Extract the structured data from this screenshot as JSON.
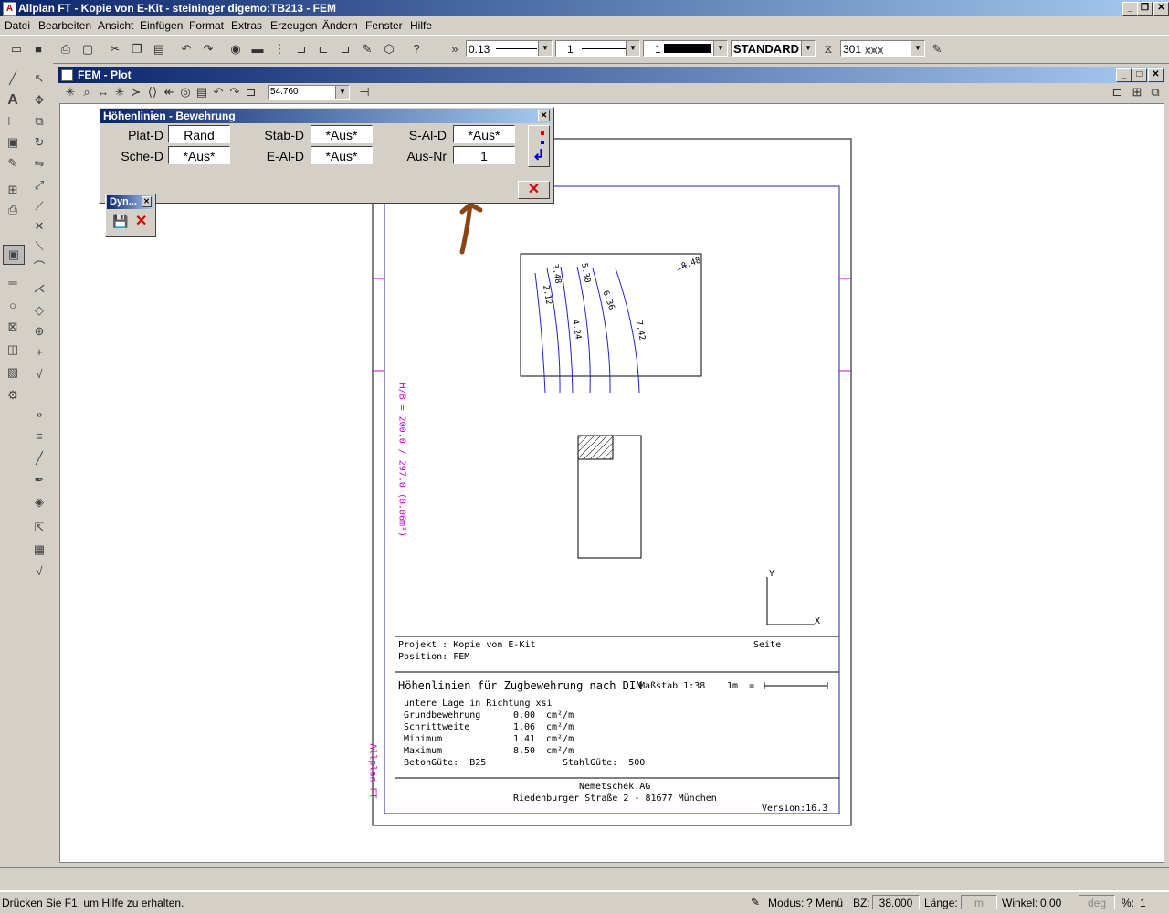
{
  "app": {
    "title": "Allplan FT - Kopie von E-Kit - steininger digemo:TB213 - FEM"
  },
  "menu": [
    "Datei",
    "Bearbeiten",
    "Ansicht",
    "Einfügen",
    "Format",
    "Extras",
    "Erzeugen",
    "Ändern",
    "Fenster",
    "Hilfe"
  ],
  "toolbar": {
    "pen": "0.13",
    "line": "1",
    "color": "1",
    "layer": "STANDARD",
    "hatch": "301"
  },
  "child": {
    "title": "FEM - Plot",
    "zoom": "54.760"
  },
  "dialog": {
    "title": "Höhenlinien - Bewehrung",
    "plat_label": "Plat-D",
    "plat_value": "Rand",
    "stab_label": "Stab-D",
    "stab_value": "*Aus*",
    "sal_label": "S-Al-D",
    "sal_value": "*Aus*",
    "sche_label": "Sche-D",
    "sche_value": "*Aus*",
    "eal_label": "E-Al-D",
    "eal_value": "*Aus*",
    "ausnr_label": "Aus-Nr",
    "ausnr_value": "1"
  },
  "dyn": {
    "title": "Dyn..."
  },
  "plot": {
    "side_label": "H/B = 200.0 / 297.0 (0.06m²)",
    "brand_side": "Allplan FT",
    "contours": [
      "2.12",
      "3.48",
      "4.24",
      "5.30",
      "6.36",
      "7.42",
      "8.48"
    ],
    "axis_y": "Y",
    "axis_x": "X",
    "projekt": "Projekt : Kopie von E-Kit",
    "seite": "Seite",
    "position": "Position: FEM",
    "heading": "Höhenlinien für Zugbewehrung nach DIN",
    "massstab": "Maßstab 1:38",
    "scale_1m": "1m  =",
    "lage": "untere Lage in Richtung xsi",
    "rows": [
      {
        "label": "Grundbewehrung",
        "value": "0.00",
        "unit": "cm²/m"
      },
      {
        "label": "Schrittweite",
        "value": "1.06",
        "unit": "cm²/m"
      },
      {
        "label": "Minimum",
        "value": "1.41",
        "unit": "cm²/m"
      },
      {
        "label": "Maximum",
        "value": "8.50",
        "unit": "cm²/m"
      }
    ],
    "beton": "BetonGüte:  B25",
    "stahl": "StahlGüte:  500",
    "company": "Nemetschek AG",
    "address": "Riedenburger Straße 2 - 81677 München",
    "version": "Version:16.3"
  },
  "status": {
    "help": "Drücken Sie F1, um Hilfe zu erhalten.",
    "modus_label": "Modus:",
    "modus_value": "? Menü",
    "bz_label": "BZ:",
    "bz_value": "38.000",
    "laenge_label": "Länge:",
    "laenge_unit": "m",
    "winkel_label": "Winkel:",
    "winkel_value": "0.00",
    "winkel_unit": "deg",
    "pct_label": "%:",
    "pct_value": "1"
  }
}
